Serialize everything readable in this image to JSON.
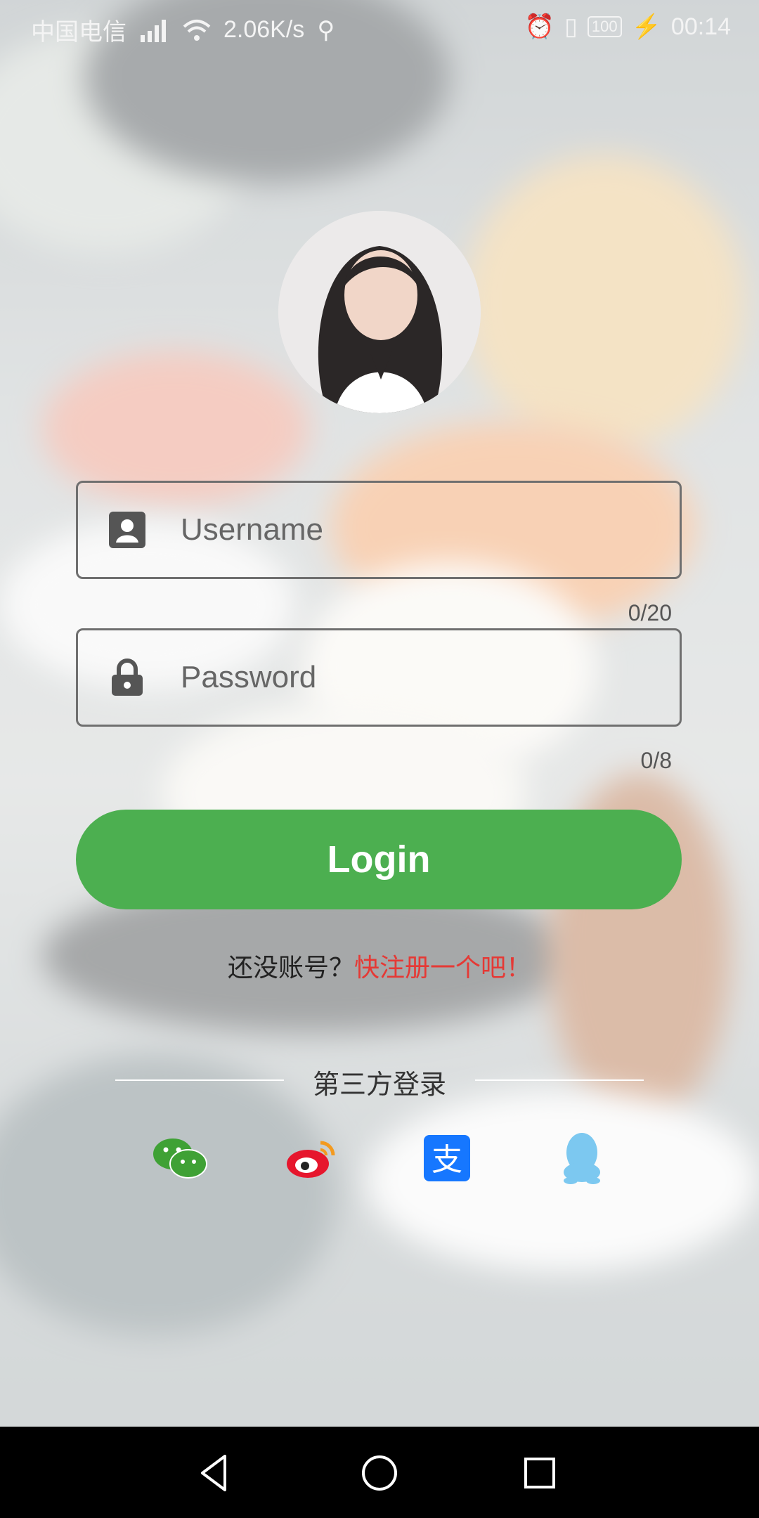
{
  "status_bar": {
    "carrier": "中国电信",
    "net_speed": "2.06K/s",
    "battery": "100",
    "time": "00:14"
  },
  "avatar": {
    "icon": "user-avatar"
  },
  "username_field": {
    "placeholder": "Username",
    "counter": "0/20",
    "icon": "person-card-icon"
  },
  "password_field": {
    "placeholder": "Password",
    "counter": "0/8",
    "icon": "lock-icon"
  },
  "login_button": {
    "label": "Login"
  },
  "register": {
    "prompt": "还没账号？",
    "link": "快注册一个吧！"
  },
  "third_party": {
    "title": "第三方登录",
    "providers": [
      "wechat-icon",
      "weibo-icon",
      "alipay-icon",
      "qq-icon"
    ]
  },
  "colors": {
    "accent": "#4caf50",
    "link": "#e53935",
    "alipay": "#1677ff",
    "qq": "#7cc8f0",
    "weibo": "#e6162d"
  }
}
